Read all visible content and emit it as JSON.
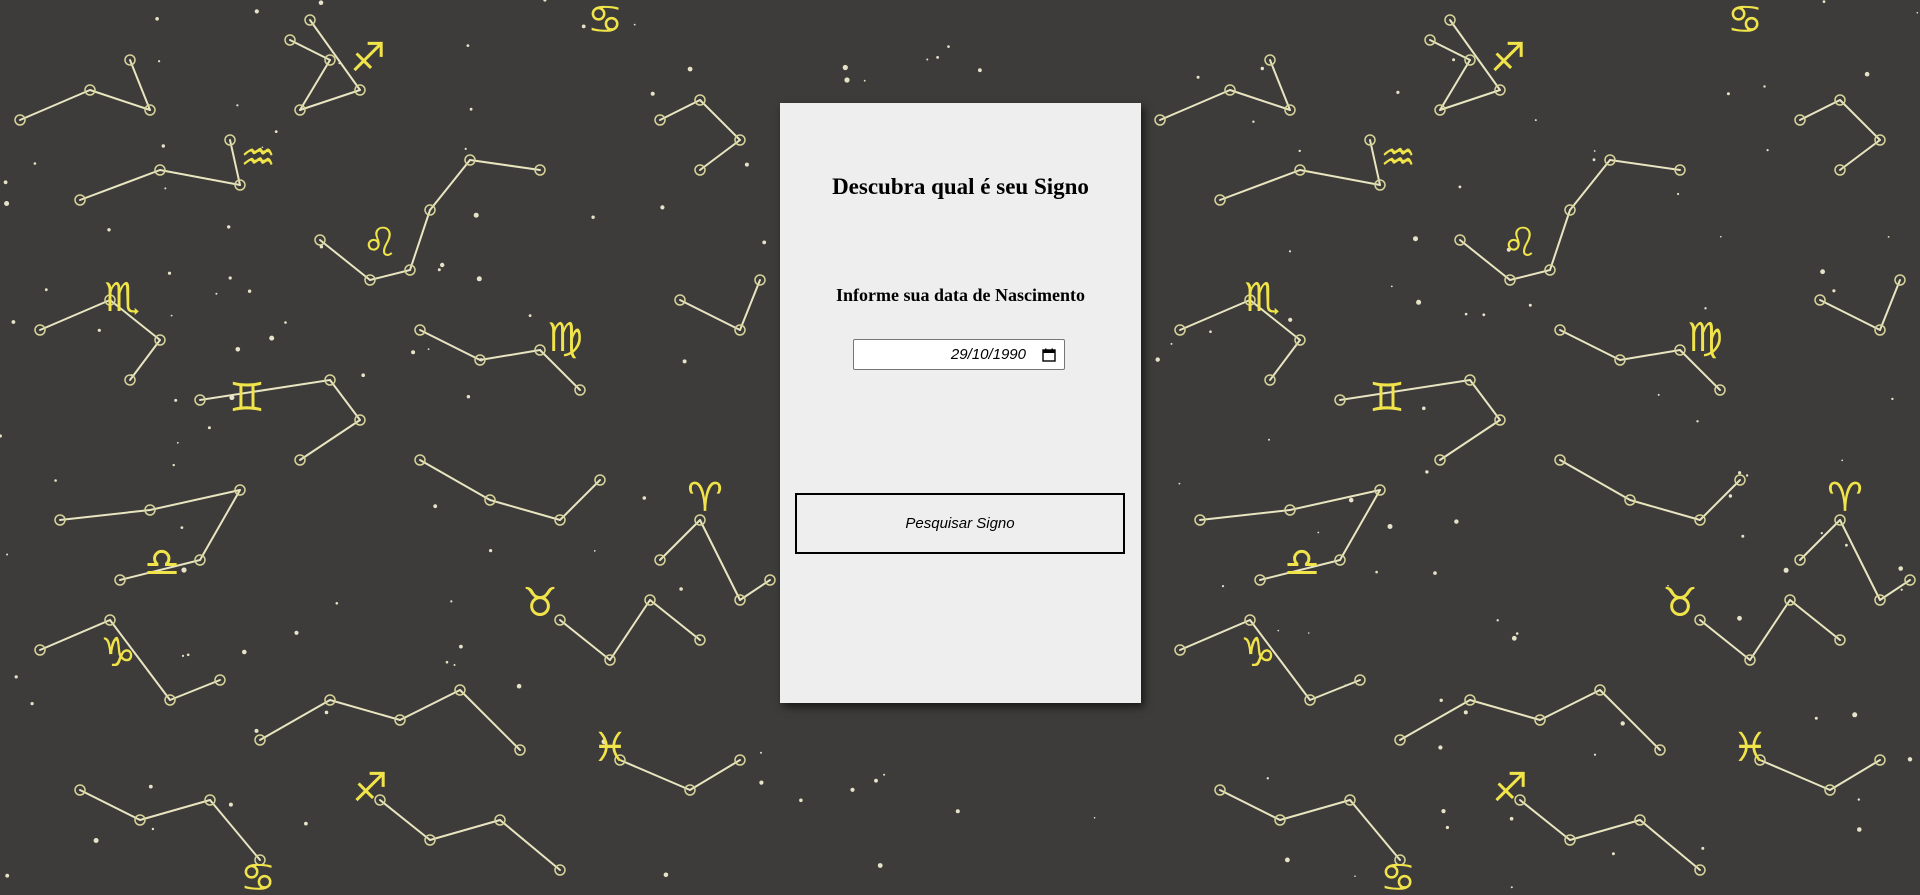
{
  "background": {
    "color": "#3d3c3a",
    "line_color": "#e8e5c0",
    "symbol_color": "#f0e44a",
    "pattern": "zodiac-constellations",
    "zodiac_glyphs": [
      "♋",
      "♐",
      "♒",
      "♌",
      "♏",
      "♍",
      "♊",
      "♈",
      "♎",
      "♉",
      "♑",
      "♓"
    ]
  },
  "card": {
    "title": "Descubra qual é seu Signo",
    "subtitle": "Informe sua data de Nascimento",
    "date_input": {
      "value": "29/10/1990",
      "icon": "calendar-icon"
    },
    "button_label": "Pesquisar Signo"
  }
}
